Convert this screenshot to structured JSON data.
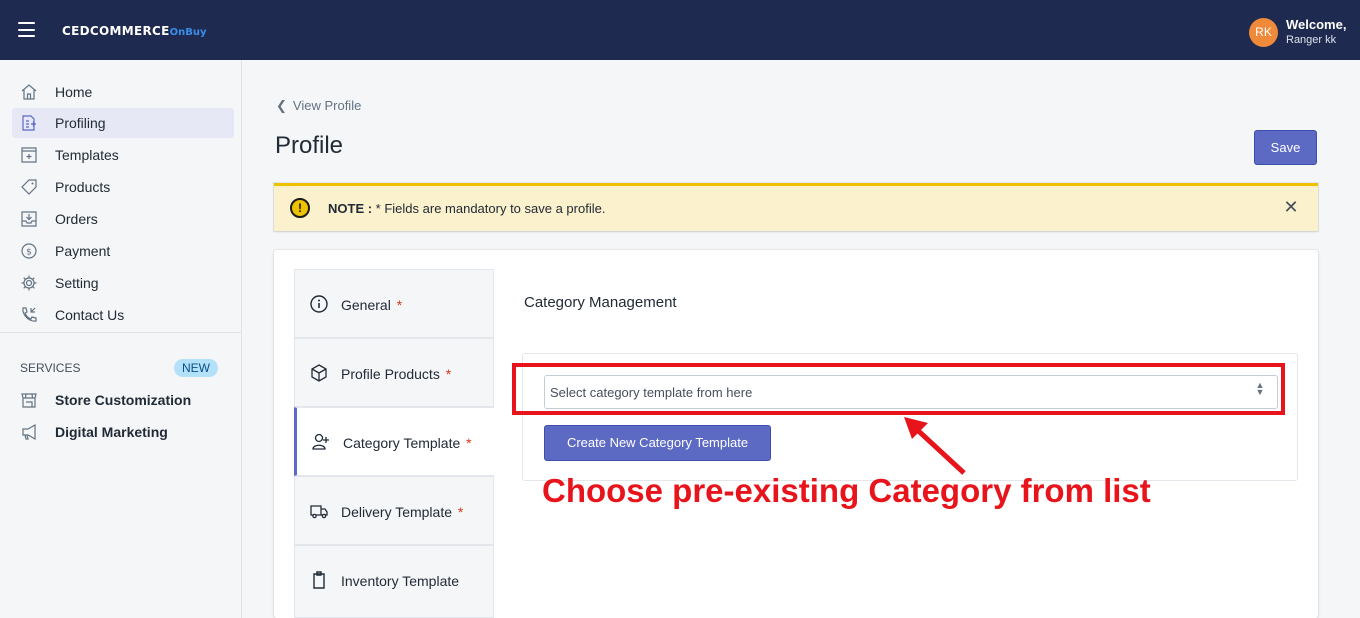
{
  "header": {
    "brand": "CEDCOMMERCE",
    "brand_suffix": "OnBuy",
    "avatar_initials": "RK",
    "welcome": "Welcome,",
    "username": "Ranger kk",
    "background": "#1e2a4f"
  },
  "sidebar": {
    "items": [
      {
        "label": "Home",
        "icon": "home-icon"
      },
      {
        "label": "Profiling",
        "icon": "profiling-icon",
        "active": true
      },
      {
        "label": "Templates",
        "icon": "templates-icon"
      },
      {
        "label": "Products",
        "icon": "tag-icon"
      },
      {
        "label": "Orders",
        "icon": "orders-icon"
      },
      {
        "label": "Payment",
        "icon": "dollar-icon"
      },
      {
        "label": "Setting",
        "icon": "gear-icon"
      },
      {
        "label": "Contact Us",
        "icon": "phone-icon"
      }
    ],
    "services_label": "SERVICES",
    "new_badge": "NEW",
    "services": [
      {
        "label": "Store Customization",
        "icon": "store-icon"
      },
      {
        "label": "Digital Marketing",
        "icon": "megaphone-icon"
      }
    ]
  },
  "main": {
    "breadcrumb": "View Profile",
    "title": "Profile",
    "save_label": "Save",
    "banner": {
      "label": "NOTE :",
      "text": " * Fields are mandatory to save a profile."
    },
    "tabs": [
      {
        "label": "General",
        "required": "*",
        "icon": "info-icon"
      },
      {
        "label": "Profile Products",
        "required": "*",
        "icon": "box-icon"
      },
      {
        "label": "Category Template",
        "required": "*",
        "icon": "user-add-icon",
        "active": true
      },
      {
        "label": "Delivery Template",
        "required": "*",
        "icon": "truck-icon"
      },
      {
        "label": "Inventory Template",
        "required": "",
        "icon": "clipboard-icon"
      }
    ],
    "section_title": "Category Management",
    "select_placeholder": "Select category template from here",
    "create_button": "Create New Category Template",
    "annotation": "Choose pre-existing Category from list"
  },
  "colors": {
    "accent": "#5c6ac4",
    "annotation": "#e8141c",
    "banner": "#fcf1cd",
    "required": "#de3618"
  }
}
